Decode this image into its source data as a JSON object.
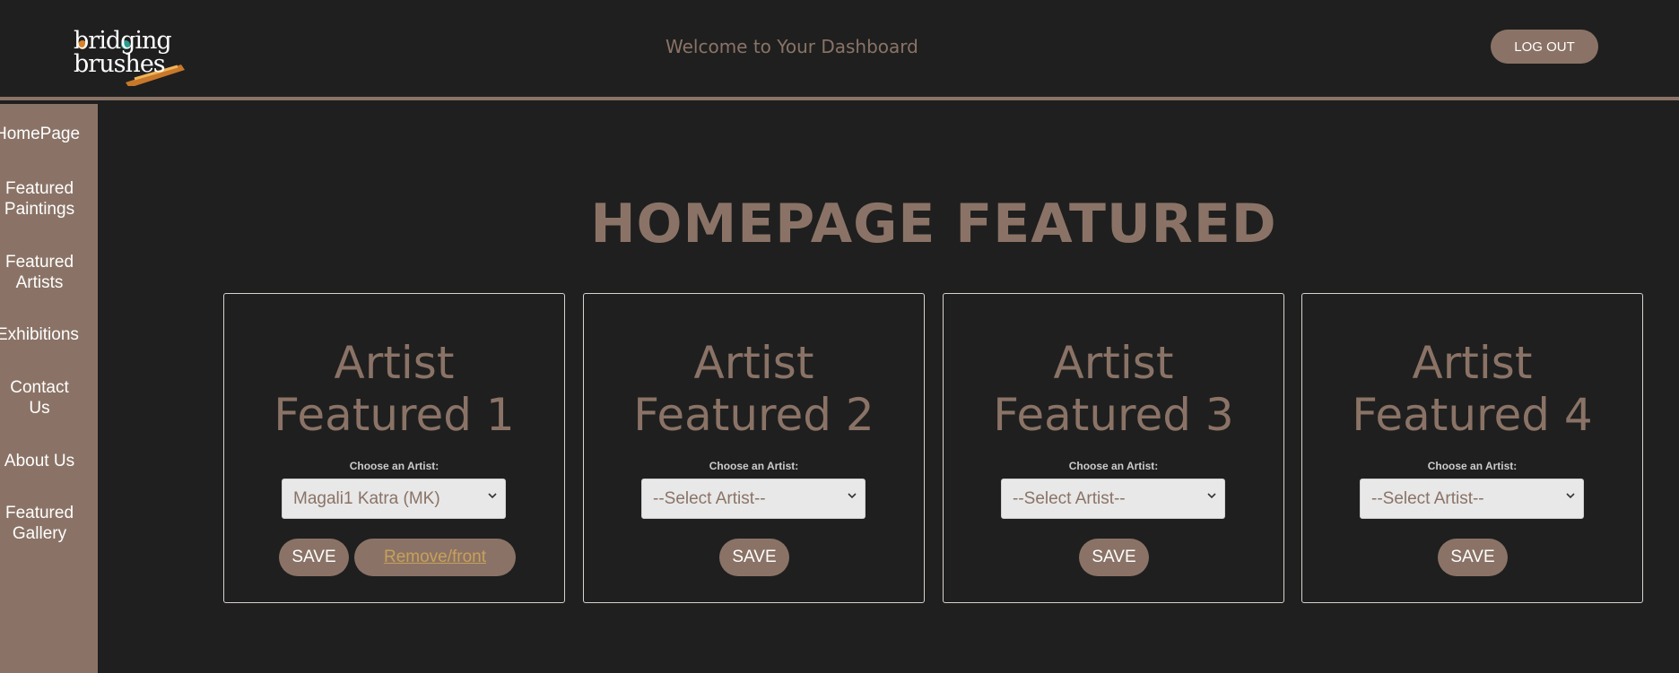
{
  "header": {
    "logo_line1": "bridging",
    "logo_line2": "brushes",
    "welcome": "Welcome to Your Dashboard",
    "logout_label": "LOG OUT"
  },
  "sidebar": {
    "items": [
      {
        "label": "HomePage"
      },
      {
        "label": "Featured\nPaintings"
      },
      {
        "label": "Featured\nArtists"
      },
      {
        "label": "Exhibitions"
      },
      {
        "label": "Contact\nUs"
      },
      {
        "label": "About Us"
      },
      {
        "label": "Featured\nGallery"
      }
    ]
  },
  "main": {
    "title": "HOMEPAGE FEATURED",
    "cards": [
      {
        "title": "Artist\nFeatured 1",
        "choose_label": "Choose an Artist:",
        "selected": "Magali1 Katra (MK)",
        "save_label": "SAVE",
        "remove_label": "Remove/front"
      },
      {
        "title": "Artist\nFeatured 2",
        "choose_label": "Choose an Artist:",
        "selected": "--Select Artist--",
        "save_label": "SAVE"
      },
      {
        "title": "Artist\nFeatured 3",
        "choose_label": "Choose an Artist:",
        "selected": "--Select Artist--",
        "save_label": "SAVE"
      },
      {
        "title": "Artist\nFeatured 4",
        "choose_label": "Choose an Artist:",
        "selected": "--Select Artist--",
        "save_label": "SAVE"
      }
    ]
  },
  "colors": {
    "background": "#1f1f1f",
    "accent": "#8a7366",
    "link": "#c9a05a"
  },
  "icons": [
    "chevron-down-icon"
  ]
}
